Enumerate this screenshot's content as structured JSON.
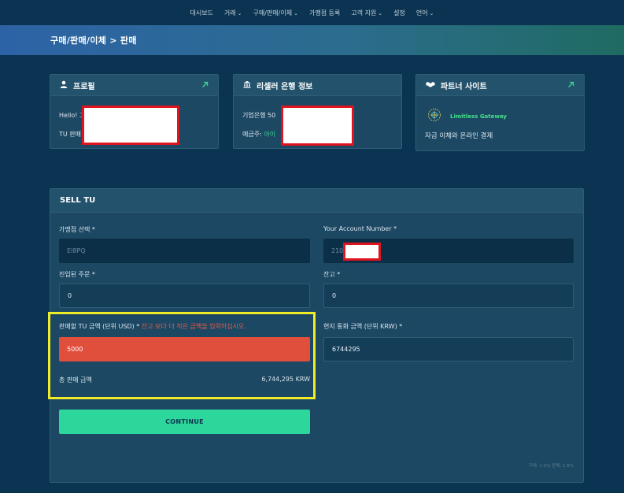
{
  "nav": {
    "items": [
      {
        "label": "대시보드",
        "dropdown": false
      },
      {
        "label": "거래",
        "dropdown": true
      },
      {
        "label": "구매/판매/이체",
        "dropdown": true
      },
      {
        "label": "가맹점 등록",
        "dropdown": false
      },
      {
        "label": "고객 지원",
        "dropdown": true
      },
      {
        "label": "설정",
        "dropdown": false
      },
      {
        "label": "언어",
        "dropdown": true
      }
    ],
    "caret": "⌄"
  },
  "breadcrumb": "구매/판매/이체 > 판매",
  "profile": {
    "title": "프로필",
    "line1": "Hello! 고",
    "line2": "TU 판매"
  },
  "bank": {
    "title": "리셀러 은행 정보",
    "line1": "기업은행 50",
    "line2_prefix": "예금주: ",
    "line2_value": "아이"
  },
  "partner": {
    "title": "파트너 사이트",
    "logo_text": "Limitless Gateway",
    "description": "자금 이체와 온라인 결제"
  },
  "sell": {
    "title": "SELL TU",
    "merchant_label": "가맹점 선택 *",
    "merchant_value": "EI8PQ",
    "account_label": "Your Account Number *",
    "account_value": "210",
    "orders_label": "진입된 주문 *",
    "orders_value": "0",
    "balance_label": "잔고 *",
    "balance_value": "0",
    "amount_label": "판매할 TU 금액 (단위 USD) * ",
    "amount_warning": "잔고 보다 더 적은 금액을 입력하십시오.",
    "amount_value": "5000",
    "local_label": "현지 통화 금액 (단위 KRW) *",
    "local_value": "6744295",
    "total_label": "총 판매 금액",
    "total_value": "6,744,295 KRW",
    "continue_label": "CONTINUE",
    "fee_text": "구매: 1.5% 판매: 1.5%"
  },
  "colors": {
    "background": "#0b3452",
    "accent_green": "#2dd69a",
    "error_red": "#e04f3c",
    "highlight_yellow": "#f1ec28",
    "redaction_red": "#e0141e"
  },
  "icons": {
    "profile": "user-icon",
    "bank": "bank-icon",
    "partner": "handshake-icon",
    "external": "external-link-arrow-icon"
  }
}
